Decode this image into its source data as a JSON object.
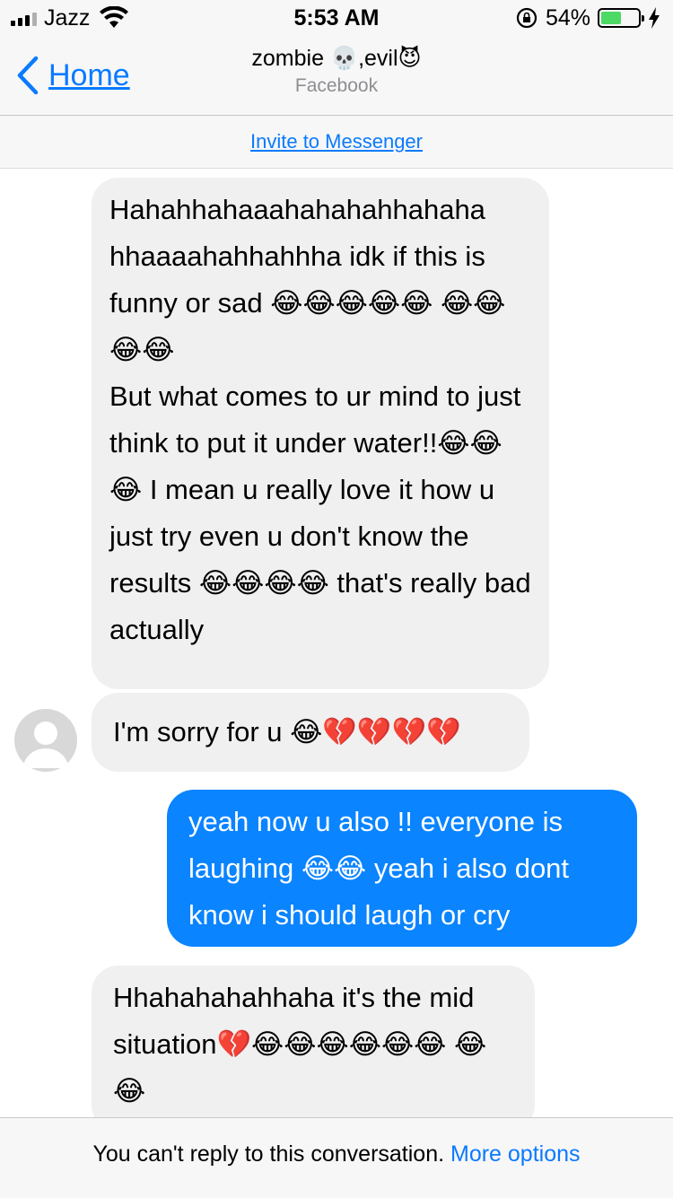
{
  "status_bar": {
    "carrier": "Jazz",
    "time": "5:53 AM",
    "battery_percent": "54%",
    "battery_level": 0.54,
    "battery_color": "#4cd964",
    "icons": [
      "signal-icon",
      "wifi-icon",
      "rotation-lock-icon",
      "battery-icon",
      "charging-icon"
    ]
  },
  "nav": {
    "back_label": "Home",
    "title": "zombie 💀,evil😈",
    "subtitle": "Facebook",
    "accent_color": "#0a7aff"
  },
  "invite": {
    "label": "Invite  to Messenger"
  },
  "messages": [
    {
      "from": "them",
      "text": "Hahahhahaaahahahahhahaha hhaaaahahhahhha idk if this is funny or sad 😂😂😂😂😂 😂😂😂😂\nBut what comes to ur mind to just think to put it under water!!😂😂😂 I mean u really love it how u just try even u don't know the results 😂😂😂😂 that's really bad actually"
    },
    {
      "from": "them",
      "text": "I'm sorry for u 😂💔💔💔💔"
    },
    {
      "from": "me",
      "text": "yeah now u also !! everyone is laughing 😂😂 yeah i also dont know i should laugh or cry"
    },
    {
      "from": "them",
      "text": "Hhahahahahhaha it's the mid situation💔😂😂😂😂😂😂 😂😂"
    }
  ],
  "footer": {
    "text": "You can't reply to this conversation.",
    "link": "More options"
  }
}
